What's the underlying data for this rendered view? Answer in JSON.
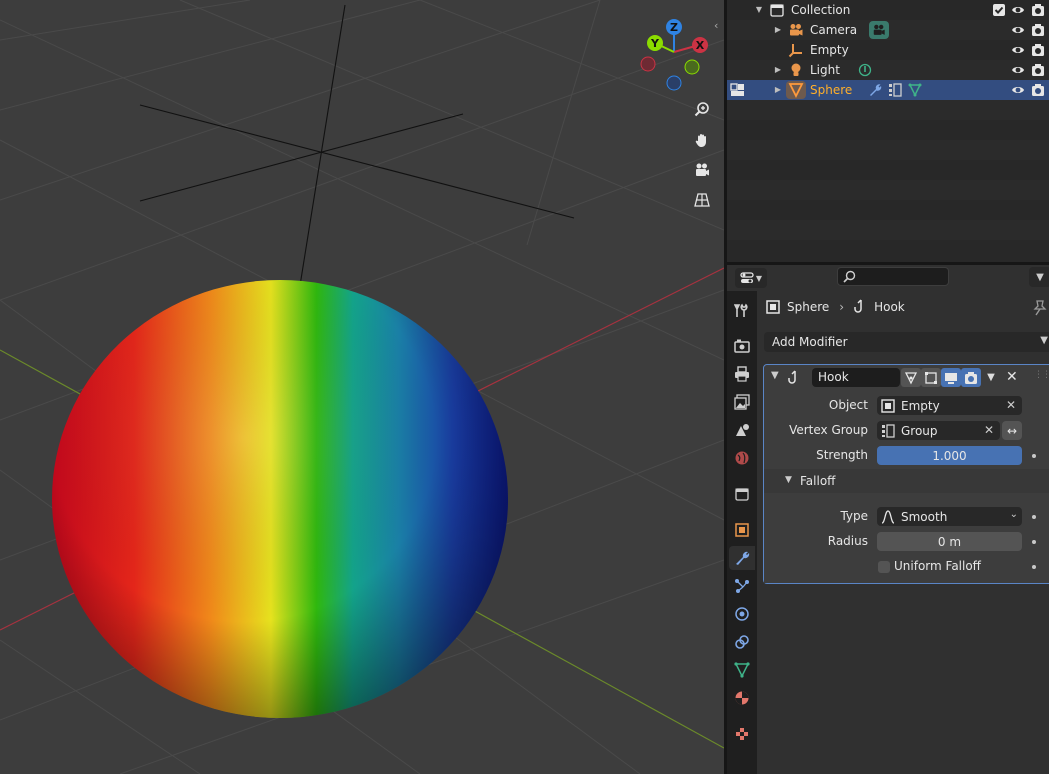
{
  "outliner": {
    "rows": [
      {
        "name": "Collection"
      },
      {
        "name": "Camera"
      },
      {
        "name": "Empty"
      },
      {
        "name": "Light"
      },
      {
        "name": "Sphere"
      }
    ]
  },
  "properties": {
    "search_placeholder": "",
    "breadcrumb": {
      "object": "Sphere",
      "modifier": "Hook"
    },
    "add_modifier_label": "Add Modifier",
    "modifier": {
      "name": "Hook",
      "object_label": "Object",
      "object_value": "Empty",
      "vertex_group_label": "Vertex Group",
      "vertex_group_value": "Group",
      "strength_label": "Strength",
      "strength_value": "1.000",
      "falloff_label": "Falloff",
      "type_label": "Type",
      "type_value": "Smooth",
      "radius_label": "Radius",
      "radius_value": "0 m",
      "uniform_falloff_label": "Uniform Falloff"
    }
  },
  "gizmo": {
    "z": "Z",
    "y": "Y",
    "x": "X"
  },
  "colors": {
    "accent_blue": "#4772b3",
    "selection": "#334d80",
    "active_object_text": "#ffaf29",
    "x_axis": "#cb3344",
    "y_axis": "#8bdc00",
    "z_axis": "#2f83e3"
  }
}
